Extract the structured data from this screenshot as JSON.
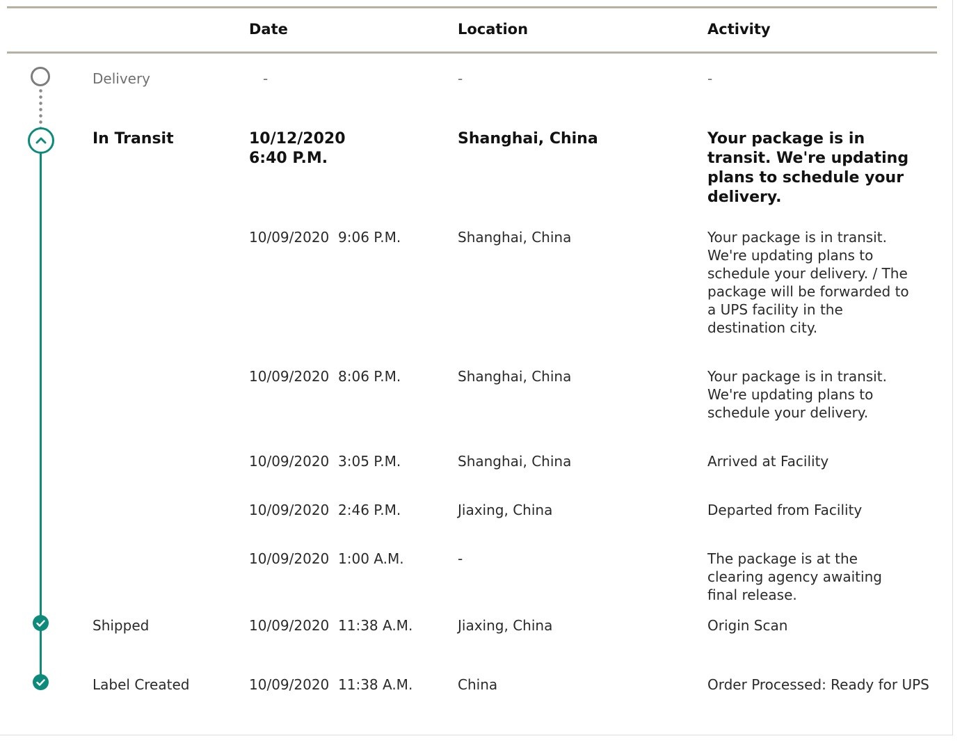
{
  "colors": {
    "accent": "#0d8b7a",
    "rule": "#b5b2a2",
    "muted": "#707070"
  },
  "headers": {
    "date": "Date",
    "location": "Location",
    "activity": "Activity"
  },
  "milestones": {
    "delivery": {
      "label": "Delivery",
      "date": "-",
      "location": "-",
      "activity": "-",
      "icon": "empty-circle-icon"
    },
    "in_transit": {
      "label": "In Transit",
      "icon": "chevron-up-icon"
    },
    "shipped": {
      "label": "Shipped",
      "icon": "check-circle-icon"
    },
    "label_created": {
      "label": "Label Created",
      "icon": "check-circle-icon"
    }
  },
  "events": [
    {
      "date": "10/12/2020",
      "time": "6:40 P.M.",
      "location": "Shanghai, China",
      "activity": "Your package is in transit. We're updating plans to schedule your delivery."
    },
    {
      "date": "10/09/2020",
      "time": "9:06 P.M.",
      "location": "Shanghai, China",
      "activity": "Your package is in transit. We're updating plans to schedule your delivery. / The package will be forwarded to a UPS facility in the destination city."
    },
    {
      "date": "10/09/2020",
      "time": "8:06 P.M.",
      "location": "Shanghai, China",
      "activity": "Your package is in transit. We're updating plans to schedule your delivery."
    },
    {
      "date": "10/09/2020",
      "time": "3:05 P.M.",
      "location": "Shanghai, China",
      "activity": "Arrived at Facility"
    },
    {
      "date": "10/09/2020",
      "time": "2:46 P.M.",
      "location": "Jiaxing, China",
      "activity": "Departed from Facility"
    },
    {
      "date": "10/09/2020",
      "time": "1:00 A.M.",
      "location": "-",
      "activity": "The package is at the clearing agency awaiting final release."
    },
    {
      "date": "10/09/2020",
      "time": "11:38 A.M.",
      "location": "Jiaxing, China",
      "activity": "Origin Scan"
    },
    {
      "date": "10/09/2020",
      "time": "11:38 A.M.",
      "location": "China",
      "activity": "Order Processed: Ready for UPS"
    }
  ]
}
